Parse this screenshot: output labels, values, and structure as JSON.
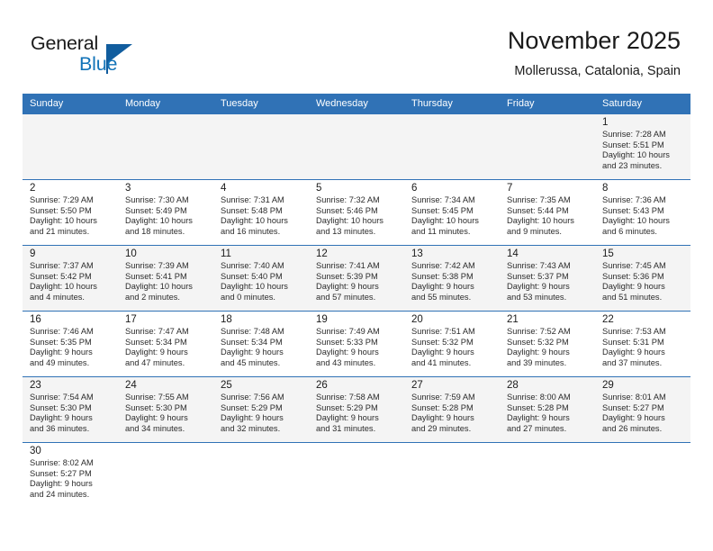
{
  "brand": {
    "name_part1": "General",
    "name_part2": "Blue",
    "logo_icon": "triangle-flag-icon",
    "accent_color": "#1273b8",
    "triangle_color": "#115d9e"
  },
  "header": {
    "month_title": "November 2025",
    "location": "Mollerussa, Catalonia, Spain"
  },
  "calendar": {
    "header_color": "#3072b6",
    "weekday_headers": [
      "Sunday",
      "Monday",
      "Tuesday",
      "Wednesday",
      "Thursday",
      "Friday",
      "Saturday"
    ],
    "weeks": [
      [
        {
          "day": "",
          "sunrise": "",
          "sunset": "",
          "daylight_line1": "",
          "daylight_line2": ""
        },
        {
          "day": "",
          "sunrise": "",
          "sunset": "",
          "daylight_line1": "",
          "daylight_line2": ""
        },
        {
          "day": "",
          "sunrise": "",
          "sunset": "",
          "daylight_line1": "",
          "daylight_line2": ""
        },
        {
          "day": "",
          "sunrise": "",
          "sunset": "",
          "daylight_line1": "",
          "daylight_line2": ""
        },
        {
          "day": "",
          "sunrise": "",
          "sunset": "",
          "daylight_line1": "",
          "daylight_line2": ""
        },
        {
          "day": "",
          "sunrise": "",
          "sunset": "",
          "daylight_line1": "",
          "daylight_line2": ""
        },
        {
          "day": "1",
          "sunrise": "Sunrise: 7:28 AM",
          "sunset": "Sunset: 5:51 PM",
          "daylight_line1": "Daylight: 10 hours",
          "daylight_line2": "and 23 minutes."
        }
      ],
      [
        {
          "day": "2",
          "sunrise": "Sunrise: 7:29 AM",
          "sunset": "Sunset: 5:50 PM",
          "daylight_line1": "Daylight: 10 hours",
          "daylight_line2": "and 21 minutes."
        },
        {
          "day": "3",
          "sunrise": "Sunrise: 7:30 AM",
          "sunset": "Sunset: 5:49 PM",
          "daylight_line1": "Daylight: 10 hours",
          "daylight_line2": "and 18 minutes."
        },
        {
          "day": "4",
          "sunrise": "Sunrise: 7:31 AM",
          "sunset": "Sunset: 5:48 PM",
          "daylight_line1": "Daylight: 10 hours",
          "daylight_line2": "and 16 minutes."
        },
        {
          "day": "5",
          "sunrise": "Sunrise: 7:32 AM",
          "sunset": "Sunset: 5:46 PM",
          "daylight_line1": "Daylight: 10 hours",
          "daylight_line2": "and 13 minutes."
        },
        {
          "day": "6",
          "sunrise": "Sunrise: 7:34 AM",
          "sunset": "Sunset: 5:45 PM",
          "daylight_line1": "Daylight: 10 hours",
          "daylight_line2": "and 11 minutes."
        },
        {
          "day": "7",
          "sunrise": "Sunrise: 7:35 AM",
          "sunset": "Sunset: 5:44 PM",
          "daylight_line1": "Daylight: 10 hours",
          "daylight_line2": "and 9 minutes."
        },
        {
          "day": "8",
          "sunrise": "Sunrise: 7:36 AM",
          "sunset": "Sunset: 5:43 PM",
          "daylight_line1": "Daylight: 10 hours",
          "daylight_line2": "and 6 minutes."
        }
      ],
      [
        {
          "day": "9",
          "sunrise": "Sunrise: 7:37 AM",
          "sunset": "Sunset: 5:42 PM",
          "daylight_line1": "Daylight: 10 hours",
          "daylight_line2": "and 4 minutes."
        },
        {
          "day": "10",
          "sunrise": "Sunrise: 7:39 AM",
          "sunset": "Sunset: 5:41 PM",
          "daylight_line1": "Daylight: 10 hours",
          "daylight_line2": "and 2 minutes."
        },
        {
          "day": "11",
          "sunrise": "Sunrise: 7:40 AM",
          "sunset": "Sunset: 5:40 PM",
          "daylight_line1": "Daylight: 10 hours",
          "daylight_line2": "and 0 minutes."
        },
        {
          "day": "12",
          "sunrise": "Sunrise: 7:41 AM",
          "sunset": "Sunset: 5:39 PM",
          "daylight_line1": "Daylight: 9 hours",
          "daylight_line2": "and 57 minutes."
        },
        {
          "day": "13",
          "sunrise": "Sunrise: 7:42 AM",
          "sunset": "Sunset: 5:38 PM",
          "daylight_line1": "Daylight: 9 hours",
          "daylight_line2": "and 55 minutes."
        },
        {
          "day": "14",
          "sunrise": "Sunrise: 7:43 AM",
          "sunset": "Sunset: 5:37 PM",
          "daylight_line1": "Daylight: 9 hours",
          "daylight_line2": "and 53 minutes."
        },
        {
          "day": "15",
          "sunrise": "Sunrise: 7:45 AM",
          "sunset": "Sunset: 5:36 PM",
          "daylight_line1": "Daylight: 9 hours",
          "daylight_line2": "and 51 minutes."
        }
      ],
      [
        {
          "day": "16",
          "sunrise": "Sunrise: 7:46 AM",
          "sunset": "Sunset: 5:35 PM",
          "daylight_line1": "Daylight: 9 hours",
          "daylight_line2": "and 49 minutes."
        },
        {
          "day": "17",
          "sunrise": "Sunrise: 7:47 AM",
          "sunset": "Sunset: 5:34 PM",
          "daylight_line1": "Daylight: 9 hours",
          "daylight_line2": "and 47 minutes."
        },
        {
          "day": "18",
          "sunrise": "Sunrise: 7:48 AM",
          "sunset": "Sunset: 5:34 PM",
          "daylight_line1": "Daylight: 9 hours",
          "daylight_line2": "and 45 minutes."
        },
        {
          "day": "19",
          "sunrise": "Sunrise: 7:49 AM",
          "sunset": "Sunset: 5:33 PM",
          "daylight_line1": "Daylight: 9 hours",
          "daylight_line2": "and 43 minutes."
        },
        {
          "day": "20",
          "sunrise": "Sunrise: 7:51 AM",
          "sunset": "Sunset: 5:32 PM",
          "daylight_line1": "Daylight: 9 hours",
          "daylight_line2": "and 41 minutes."
        },
        {
          "day": "21",
          "sunrise": "Sunrise: 7:52 AM",
          "sunset": "Sunset: 5:32 PM",
          "daylight_line1": "Daylight: 9 hours",
          "daylight_line2": "and 39 minutes."
        },
        {
          "day": "22",
          "sunrise": "Sunrise: 7:53 AM",
          "sunset": "Sunset: 5:31 PM",
          "daylight_line1": "Daylight: 9 hours",
          "daylight_line2": "and 37 minutes."
        }
      ],
      [
        {
          "day": "23",
          "sunrise": "Sunrise: 7:54 AM",
          "sunset": "Sunset: 5:30 PM",
          "daylight_line1": "Daylight: 9 hours",
          "daylight_line2": "and 36 minutes."
        },
        {
          "day": "24",
          "sunrise": "Sunrise: 7:55 AM",
          "sunset": "Sunset: 5:30 PM",
          "daylight_line1": "Daylight: 9 hours",
          "daylight_line2": "and 34 minutes."
        },
        {
          "day": "25",
          "sunrise": "Sunrise: 7:56 AM",
          "sunset": "Sunset: 5:29 PM",
          "daylight_line1": "Daylight: 9 hours",
          "daylight_line2": "and 32 minutes."
        },
        {
          "day": "26",
          "sunrise": "Sunrise: 7:58 AM",
          "sunset": "Sunset: 5:29 PM",
          "daylight_line1": "Daylight: 9 hours",
          "daylight_line2": "and 31 minutes."
        },
        {
          "day": "27",
          "sunrise": "Sunrise: 7:59 AM",
          "sunset": "Sunset: 5:28 PM",
          "daylight_line1": "Daylight: 9 hours",
          "daylight_line2": "and 29 minutes."
        },
        {
          "day": "28",
          "sunrise": "Sunrise: 8:00 AM",
          "sunset": "Sunset: 5:28 PM",
          "daylight_line1": "Daylight: 9 hours",
          "daylight_line2": "and 27 minutes."
        },
        {
          "day": "29",
          "sunrise": "Sunrise: 8:01 AM",
          "sunset": "Sunset: 5:27 PM",
          "daylight_line1": "Daylight: 9 hours",
          "daylight_line2": "and 26 minutes."
        }
      ],
      [
        {
          "day": "30",
          "sunrise": "Sunrise: 8:02 AM",
          "sunset": "Sunset: 5:27 PM",
          "daylight_line1": "Daylight: 9 hours",
          "daylight_line2": "and 24 minutes."
        },
        {
          "day": "",
          "sunrise": "",
          "sunset": "",
          "daylight_line1": "",
          "daylight_line2": ""
        },
        {
          "day": "",
          "sunrise": "",
          "sunset": "",
          "daylight_line1": "",
          "daylight_line2": ""
        },
        {
          "day": "",
          "sunrise": "",
          "sunset": "",
          "daylight_line1": "",
          "daylight_line2": ""
        },
        {
          "day": "",
          "sunrise": "",
          "sunset": "",
          "daylight_line1": "",
          "daylight_line2": ""
        },
        {
          "day": "",
          "sunrise": "",
          "sunset": "",
          "daylight_line1": "",
          "daylight_line2": ""
        },
        {
          "day": "",
          "sunrise": "",
          "sunset": "",
          "daylight_line1": "",
          "daylight_line2": ""
        }
      ]
    ]
  }
}
